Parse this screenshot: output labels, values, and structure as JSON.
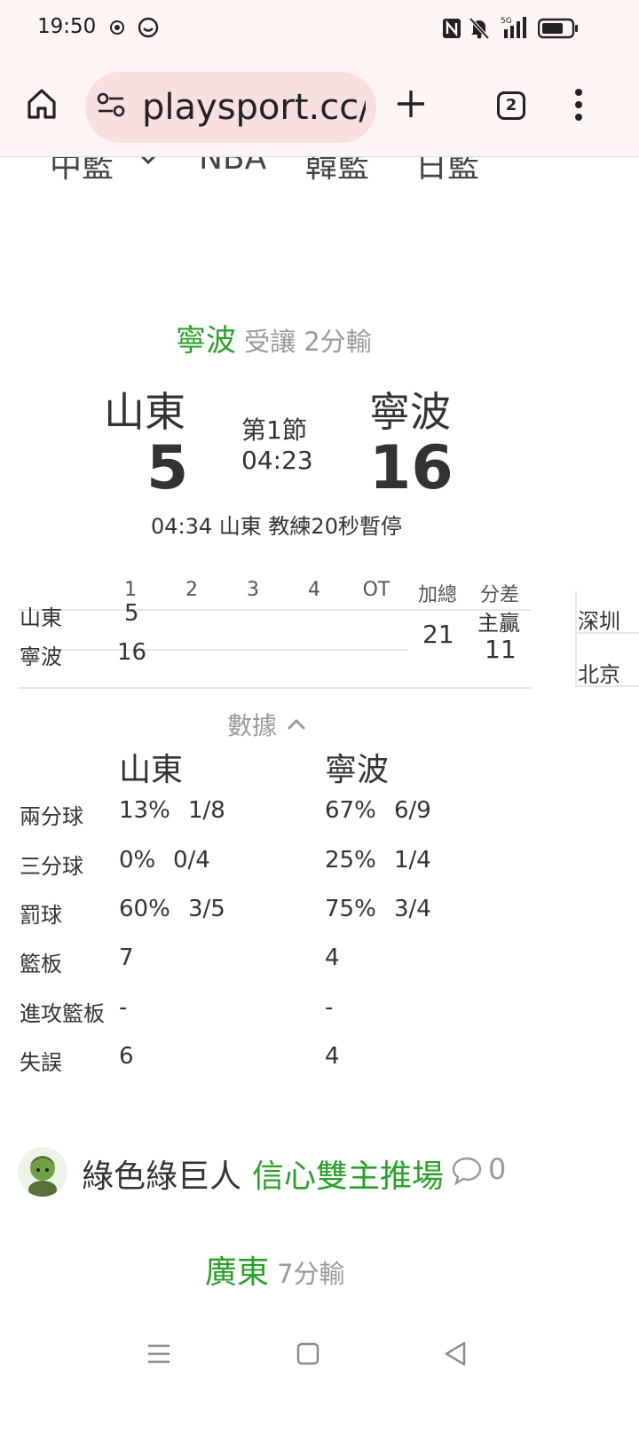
{
  "status_bar": {
    "time": "19:50"
  },
  "browser": {
    "url": "playsport.cc/",
    "tab_count": "2"
  },
  "league_nav": [
    "中籃",
    "NBA",
    "韓籃",
    "日籃"
  ],
  "handicap": {
    "team": "寧波",
    "text": "受讓 2分輸"
  },
  "game": {
    "home": {
      "name": "山東",
      "score": "5"
    },
    "away": {
      "name": "寧波",
      "score": "16"
    },
    "period": "第1節",
    "clock": "04:23",
    "event": "04:34 山東 教練20秒暫停"
  },
  "quarter_table": {
    "headers": [
      "1",
      "2",
      "3",
      "4",
      "OT",
      "加總",
      "分差"
    ],
    "rows": [
      {
        "team": "山東",
        "q1": "5"
      },
      {
        "team": "寧波",
        "q1": "16"
      }
    ],
    "total": "21",
    "diff_label": "主贏",
    "diff_value": "11",
    "side_teams": [
      "深圳",
      "北京"
    ]
  },
  "stats_toggle": {
    "label": "數據"
  },
  "stats": {
    "home_name": "山東",
    "away_name": "寧波",
    "rows": [
      {
        "label": "兩分球",
        "home_pct": "13%",
        "home_ratio": "1/8",
        "away_pct": "67%",
        "away_ratio": "6/9"
      },
      {
        "label": "三分球",
        "home_pct": "0%",
        "home_ratio": "0/4",
        "away_pct": "25%",
        "away_ratio": "1/4"
      },
      {
        "label": "罰球",
        "home_pct": "60%",
        "home_ratio": "3/5",
        "away_pct": "75%",
        "away_ratio": "3/4"
      },
      {
        "label": "籃板",
        "home_pct": "7",
        "home_ratio": "",
        "away_pct": "4",
        "away_ratio": ""
      },
      {
        "label": "進攻籃板",
        "home_pct": "-",
        "home_ratio": "",
        "away_pct": "-",
        "away_ratio": ""
      },
      {
        "label": "失誤",
        "home_pct": "6",
        "home_ratio": "",
        "away_pct": "4",
        "away_ratio": ""
      }
    ]
  },
  "post": {
    "author": "綠色綠巨人",
    "title": "信心雙主推場",
    "comment_count": "0"
  },
  "next_pick": {
    "team": "廣東",
    "text": "7分輸"
  },
  "colors": {
    "accent_green": "#2aa02a",
    "chrome_bg": "#fdf4f4",
    "urlbar_bg": "#f8dfe0"
  }
}
